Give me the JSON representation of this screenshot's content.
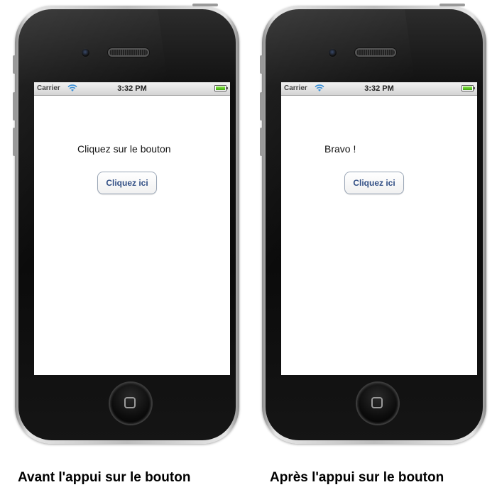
{
  "phones": [
    {
      "status_bar": {
        "carrier": "Carrier",
        "time": "3:32 PM",
        "wifi_icon": "wifi-icon",
        "battery_icon": "battery-icon"
      },
      "label": "Cliquez sur le bouton",
      "button_label": "Cliquez ici",
      "caption": "Avant l'appui sur le bouton"
    },
    {
      "status_bar": {
        "carrier": "Carrier",
        "time": "3:32 PM",
        "wifi_icon": "wifi-icon",
        "battery_icon": "battery-icon"
      },
      "label": "Bravo !",
      "button_label": "Cliquez ici",
      "caption": "Après l'appui sur le bouton"
    }
  ],
  "colors": {
    "button_text": "#324f85",
    "battery_fill": "#4fc11a",
    "wifi": "#3a8fd6"
  }
}
